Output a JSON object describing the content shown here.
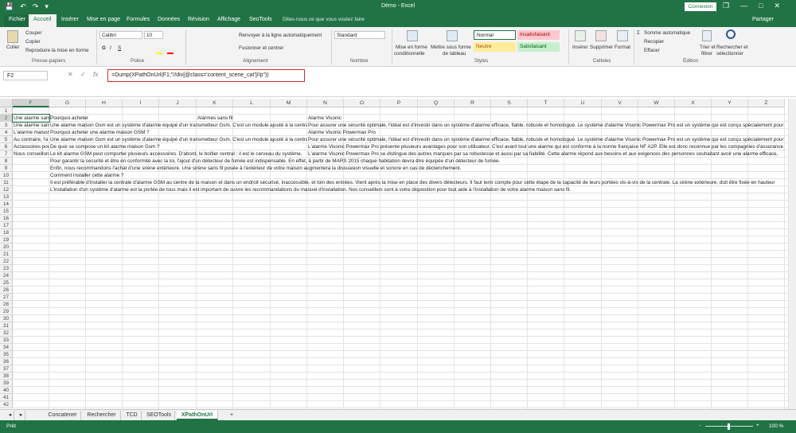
{
  "window": {
    "title": "Démo  -  Excel",
    "connexion": "Connexion",
    "min": "—",
    "max": "□",
    "close": "✕",
    "restore": "❐"
  },
  "qat": {
    "save": "💾",
    "undo": "↶",
    "redo": "↷",
    "more": "▾"
  },
  "tabs": {
    "file": "Fichier",
    "home": "Accueil",
    "insert": "Insérer",
    "layout": "Mise en page",
    "formulas": "Formules",
    "data": "Données",
    "review": "Révision",
    "view": "Affichage",
    "seotools": "SeoTools",
    "tellme": "Dites-nous ce que vous voulez faire",
    "share": "Partager"
  },
  "ribbon": {
    "paste": "Coller",
    "cut": "Couper",
    "copy": "Copier",
    "format_painter": "Reproduire la mise en forme",
    "clipboard": "Presse-papiers",
    "font_name": "Calibri",
    "font_size": "10",
    "bold": "G",
    "italic": "I",
    "underline": "S",
    "font_group": "Police",
    "wrap": "Renvoyer à la ligne automatiquement",
    "merge": "Fusionner et centrer",
    "alignment_group": "Alignement",
    "number_format": "Standard",
    "number_group": "Nombre",
    "cond_format": "Mise en forme\nconditionnelle",
    "cond_format_l1": "Mise en forme",
    "cond_format_l2": "conditionnelle",
    "table_format_l1": "Mettre sous forme",
    "table_format_l2": "de tableau",
    "style_normal": "Normal",
    "style_bad": "Insatisfaisant",
    "style_neutral": "Neutre",
    "style_good": "Satisfaisant",
    "styles_group": "Styles",
    "insert": "Insérer",
    "delete": "Supprimer",
    "format": "Format",
    "cells_group": "Cellules",
    "autosum": "Somme automatique",
    "fill": "Recopier",
    "clear": "Effacer",
    "sort_l1": "Trier et",
    "sort_l2": "filtrer",
    "find_l1": "Rechercher et",
    "find_l2": "sélectionner",
    "edition_group": "Édition"
  },
  "formula_bar": {
    "namebox": "F2",
    "cancel": "✕",
    "enter": "✓",
    "fx": "fx",
    "formula": "=Dump(XPathOnUrl(F1;\"//div[@class='content_scene_cat']//p\"))"
  },
  "columns": [
    "F",
    "G",
    "H",
    "I",
    "J",
    "K",
    "L",
    "M",
    "N",
    "O",
    "P",
    "Q",
    "R",
    "S",
    "T",
    "U",
    "V",
    "W",
    "X",
    "Y",
    "Z"
  ],
  "rows": [
    "1",
    "2",
    "3",
    "4",
    "5",
    "6",
    "7",
    "8",
    "9",
    "10",
    "11",
    "12",
    "13",
    "14",
    "15",
    "16",
    "17",
    "18",
    "19",
    "20",
    "21",
    "22",
    "23",
    "24",
    "25",
    "26",
    "27",
    "28",
    "29",
    "30",
    "31",
    "32",
    "33",
    "34",
    "35",
    "36",
    "37",
    "38",
    "39",
    "40",
    "41",
    "42"
  ],
  "cells": {
    "f2": "Une alarme sans fil",
    "g2": "Pourquoi acheter",
    "k2": "Alarmes sans fil",
    "n2": "Alarme Visonic",
    "f3": "Une alarme sans fil",
    "g3": "Une alarme maison Gsm est un système d'alarme équipé d'un transmetteur Gsm. C'est un module ajouté à la centrale",
    "n3": "Pour assurer une sécurité optimale, l'idéal est d'investir dans un système d'alarme efficace, fiable, robuste et homologué. Le système d'alarme Visonic Powermax Pro est un système qui est conçu spécialement pour",
    "f4": "L'alarme maison",
    "g4": "Pourquoi acheter une alarme maison GSM ?",
    "n4": "Alarme Visonic Powermax Pro",
    "f5": "Au contraire, l'a",
    "g5": "Une alarme maison Gsm est un système d'alarme équipé d'un transmetteur Gsm. C'est un module ajouté à la centrale",
    "n5": "Pour assurer une sécurité optimale, l'idéal est d'investir dans un système d'alarme efficace, fiable, robuste et homologué. Le système d'alarme Visonic Powermax Pro est un système qui est conçu spécialement pour",
    "f6": "Accessoires pou",
    "g6": "De quoi se compose un kit alarme maison Gsm ?",
    "n6": "L'alarme Visonic Powermax Pro présente plusieurs avantages pour son utilisateur. C'est avant tout une alarme qui est conforme à la norme française NF A2P. Elle est donc reconnue par les compagnies d'assurance",
    "f7": "Nous conseillon",
    "g7": "Le kit alarme GSM peut comporter plusieurs accessoires. D'abord, le boîtier central : il est le cerveau du système.",
    "n7": "L'alarme Visonic Powermax Pro se distingue des autres marques par sa robustesse et aussi par sa fiabilité. Cette alarme répond aux besoins et aux exigences des personnes souhaitant avoir une alarme efficace,",
    "g8": "Pour garantir la sécurité et être en conformité avec la loi, l'ajout d'un détecteur de fumée est indispensable. En effet, à partir de MARS 2015 chaque habitation devra être équipée d'un détecteur de fumée.",
    "g9": "Enfin, nous recommandons l'achat d'une sirène extérieure. Une sirène sans fil posée à l'extérieur de votre maison augmentera la dissuasion visuelle et sonore en cas de déclenchement.",
    "g10": "Comment installer cette alarme ?",
    "g11": "Il est préférable d'installer la centrale d'alarme GSM au centre de la maison et dans un endroit sécurisé, inaccessible, et loin des entrées. Vient après la mise en place des divers détecteurs. Il faut tenir compte pour cette étape de la capacité de leurs portées vis-à-vis de la centrale. La sirène extérieure, doit être fixée en hauteur",
    "g12": "L'installation d'un système d'alarme est la portée de tous mais il est important de suivre les recommandations du manuel d'installation. Nos conseillers sont à votre disposition pour tout aide à l'installation de votre alarme maison sans fil."
  },
  "sheets": [
    "Concatener",
    "Rechercher",
    "TCD",
    "SEOTools",
    "XPathOnUrl"
  ],
  "sheet_add": "+",
  "status": {
    "ready": "Prêt",
    "zoom": "100 %",
    "zoom_minus": "-",
    "zoom_plus": "+"
  },
  "colors": {
    "excel_green": "#217346",
    "normal_border": "#217346",
    "bad_bg": "#ffc7ce",
    "bad_fg": "#9c0006",
    "neutral_bg": "#ffeb9c",
    "neutral_fg": "#9c5700",
    "good_bg": "#c6efce",
    "good_fg": "#006100"
  }
}
